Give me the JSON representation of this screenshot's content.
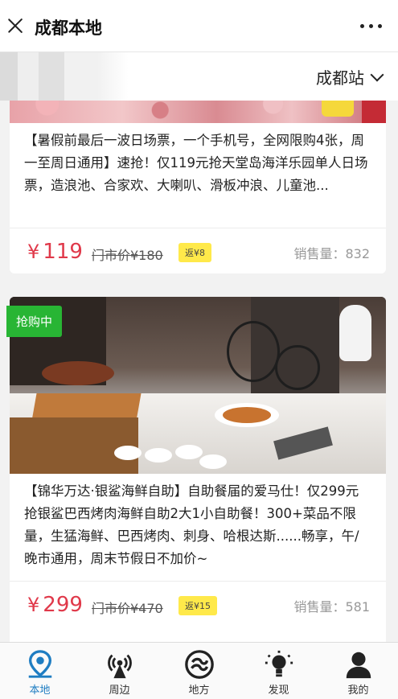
{
  "titlebar": {
    "title": "成都本地"
  },
  "citybar": {
    "city": "成都站"
  },
  "listings": [
    {
      "description": "【暑假前最后一波日场票，一个手机号，全网限购4张，周一至周日通用】速抢！仅119元抢天堂岛海洋乐园单人日场票，造浪池、合家欢、大喇叭、滑板冲浪、儿童池...",
      "currency": "¥",
      "price": "119",
      "original_price": "门市价¥180",
      "rebate": "返¥8",
      "sold_label": "销售量：",
      "sold_count": "832"
    },
    {
      "badge": "抢购中",
      "description": "【锦华万达·银鲨海鲜自助】自助餐届的爱马仕！仅299元抢银鲨巴西烤肉海鲜自助2大1小自助餐！300+菜品不限量，生猛海鲜、巴西烤肉、刺身、哈根达斯......畅享，午/晚市通用，周末节假日不加价~",
      "currency": "¥",
      "price": "299",
      "original_price": "门市价¥470",
      "rebate": "返¥15",
      "sold_label": "销售量：",
      "sold_count": "581"
    }
  ],
  "tabs": [
    {
      "label": "本地",
      "icon": "location-pin-icon",
      "active": true
    },
    {
      "label": "周边",
      "icon": "radio-tower-icon",
      "active": false
    },
    {
      "label": "地方",
      "icon": "swirl-circle-icon",
      "active": false
    },
    {
      "label": "发现",
      "icon": "lightbulb-icon",
      "active": false
    },
    {
      "label": "我的",
      "icon": "user-icon",
      "active": false
    }
  ],
  "colors": {
    "accent": "#1f7dc2",
    "price": "#e0394a",
    "badge_green": "#28b534",
    "rebate_yellow": "#ffe94a"
  }
}
